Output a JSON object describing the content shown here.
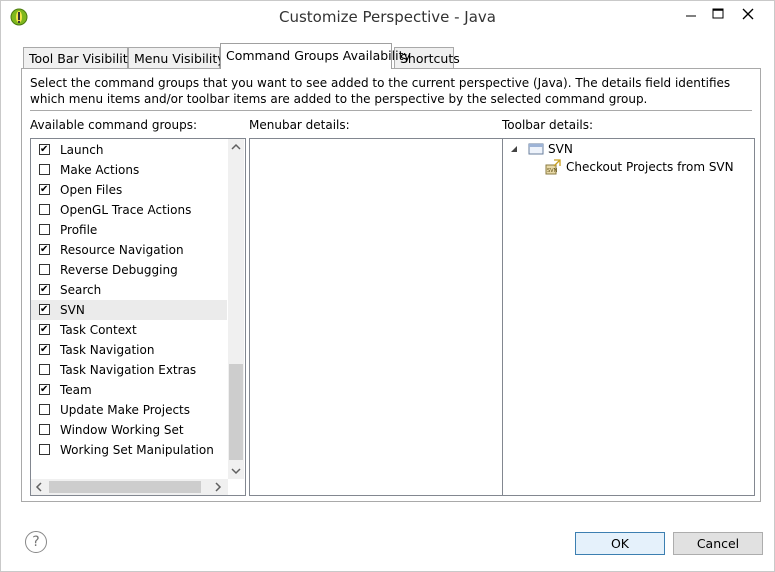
{
  "window": {
    "title": "Customize Perspective - Java"
  },
  "tabs": [
    {
      "label": "Tool Bar Visibility"
    },
    {
      "label": "Menu Visibility"
    },
    {
      "label": "Command Groups Availability"
    },
    {
      "label": "Shortcuts"
    }
  ],
  "description": "Select the command groups that you want to see added to the current perspective (Java).  The details field identifies which menu items and/or toolbar items are added to the perspective by the selected command group.",
  "labels": {
    "available": "Available command groups:",
    "menubar": "Menubar details:",
    "toolbar": "Toolbar details:"
  },
  "command_groups": [
    {
      "label": "Launch",
      "checked": true
    },
    {
      "label": "Make Actions",
      "checked": false
    },
    {
      "label": "Open Files",
      "checked": true
    },
    {
      "label": "OpenGL Trace Actions",
      "checked": false
    },
    {
      "label": "Profile",
      "checked": false
    },
    {
      "label": "Resource Navigation",
      "checked": true
    },
    {
      "label": "Reverse Debugging",
      "checked": false
    },
    {
      "label": "Search",
      "checked": true
    },
    {
      "label": "SVN",
      "checked": true,
      "selected": true
    },
    {
      "label": "Task Context",
      "checked": true
    },
    {
      "label": "Task Navigation",
      "checked": true
    },
    {
      "label": "Task Navigation Extras",
      "checked": false
    },
    {
      "label": "Team",
      "checked": true
    },
    {
      "label": "Update Make Projects",
      "checked": false
    },
    {
      "label": "Window Working Set",
      "checked": false
    },
    {
      "label": "Working Set Manipulation",
      "checked": false
    }
  ],
  "toolbar_details": {
    "group": "SVN",
    "item": "Checkout Projects from SVN"
  },
  "buttons": {
    "ok": "OK",
    "cancel": "Cancel",
    "help_glyph": "?"
  },
  "icons": {
    "app": "eclipse-app-icon",
    "minimize": "minimize-icon",
    "maximize": "maximize-icon",
    "close": "close-icon"
  }
}
